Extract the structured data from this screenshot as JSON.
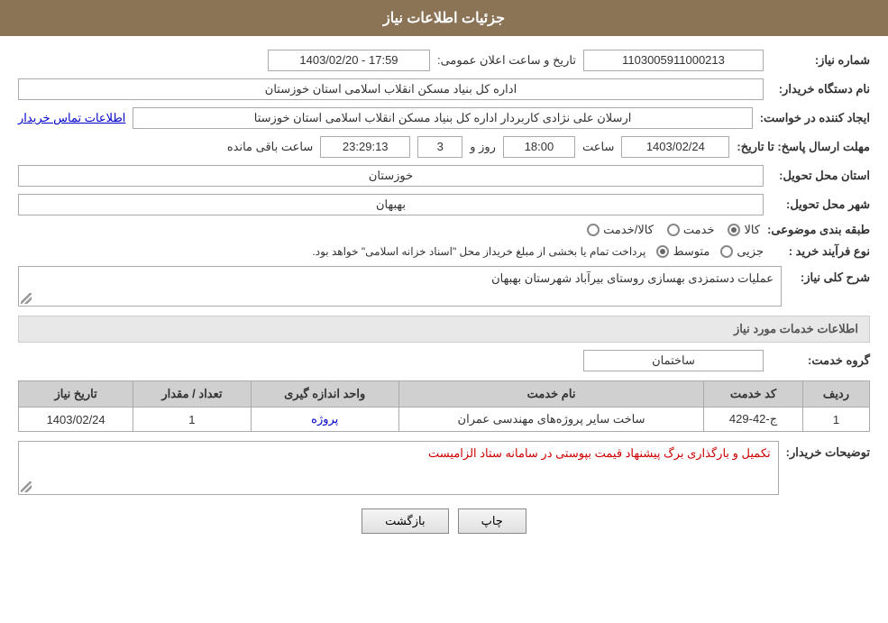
{
  "header": {
    "title": "جزئیات اطلاعات نیاز"
  },
  "fields": {
    "need_number_label": "شماره نیاز:",
    "need_number_value": "1103005911000213",
    "date_label": "تاریخ و ساعت اعلان عمومی:",
    "date_value": "1403/02/20 - 17:59",
    "buyer_name_label": "نام دستگاه خریدار:",
    "buyer_name_value": "اداره کل بنیاد مسکن انقلاب اسلامی استان خوزستان",
    "creator_label": "ایجاد کننده در خواست:",
    "creator_value": "ارسلان علی نژادی کاربردار اداره کل بنیاد مسکن انقلاب اسلامی استان خوزستا",
    "contact_link": "اطلاعات تماس خریدار",
    "response_deadline_label": "مهلت ارسال پاسخ: تا تاریخ:",
    "response_date": "1403/02/24",
    "response_time_label": "ساعت",
    "response_time": "18:00",
    "response_days_label": "روز و",
    "response_days": "3",
    "response_remaining_label": "ساعت باقی مانده",
    "response_remaining": "23:29:13",
    "province_label": "استان محل تحویل:",
    "province_value": "خوزستان",
    "city_label": "شهر محل تحویل:",
    "city_value": "بهبهان",
    "classification_label": "طبقه بندی موضوعی:",
    "radio_options": [
      {
        "label": "کالا",
        "selected": true
      },
      {
        "label": "خدمت",
        "selected": false
      },
      {
        "label": "کالا/خدمت",
        "selected": false
      }
    ],
    "process_label": "نوع فرآیند خرید :",
    "process_options": [
      {
        "label": "جزیی",
        "selected": false
      },
      {
        "label": "متوسط",
        "selected": true
      }
    ],
    "process_description": "پرداخت تمام یا بخشی از مبلغ خریداز محل \"اسناد خزانه اسلامی\" خواهد بود.",
    "narration_label": "شرح کلی نیاز:",
    "narration_value": "عملیات دستمزدی بهسازی روستای بیرآباد  شهرستان بهبهان",
    "services_section_title": "اطلاعات خدمات مورد نیاز",
    "service_group_label": "گروه خدمت:",
    "service_group_value": "ساختمان",
    "table": {
      "headers": [
        "ردیف",
        "کد خدمت",
        "نام خدمت",
        "واحد اندازه گیری",
        "تعداد / مقدار",
        "تاریخ نیاز"
      ],
      "rows": [
        {
          "row": "1",
          "code": "ج-42-429",
          "name": "ساخت سایر پروژه‌های مهندسی عمران",
          "unit": "پروژه",
          "count": "1",
          "date": "1403/02/24"
        }
      ]
    },
    "buyer_notes_label": "توضیحات خریدار:",
    "buyer_notes_value": "تکمیل و بارگذاری برگ پیشنهاد قیمت بپوستی در سامانه ستاد الزامیست"
  },
  "buttons": {
    "print": "چاپ",
    "back": "بازگشت"
  }
}
